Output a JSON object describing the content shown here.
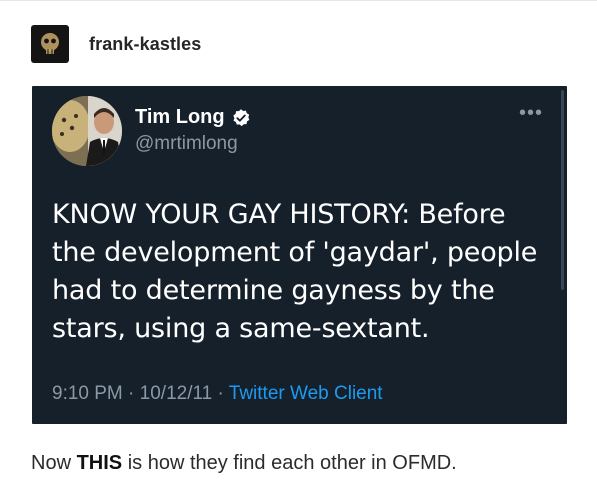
{
  "post": {
    "blog_name": "frank-kastles",
    "blog_avatar_icon": "skull-emblem-icon",
    "caption": {
      "before": "Now ",
      "emphasis": "THIS",
      "after": " is how they find each other in OFMD."
    }
  },
  "tweet": {
    "author_name": "Tim Long",
    "handle": "@mrtimlong",
    "verified_icon": "verified-badge-icon",
    "more_icon": "more-dots-icon",
    "text_lines": [
      "KNOW YOUR GAY HISTORY: Before",
      "the development of 'gaydar', people",
      "had to determine gayness by the",
      "stars, using a same-sextant."
    ],
    "time": "9:10 PM",
    "date": "10/12/11",
    "separator": "·",
    "source": "Twitter Web Client"
  },
  "colors": {
    "card_background": "#15202b",
    "link_blue": "#1d9bf0",
    "muted_text": "#8b98a5"
  }
}
